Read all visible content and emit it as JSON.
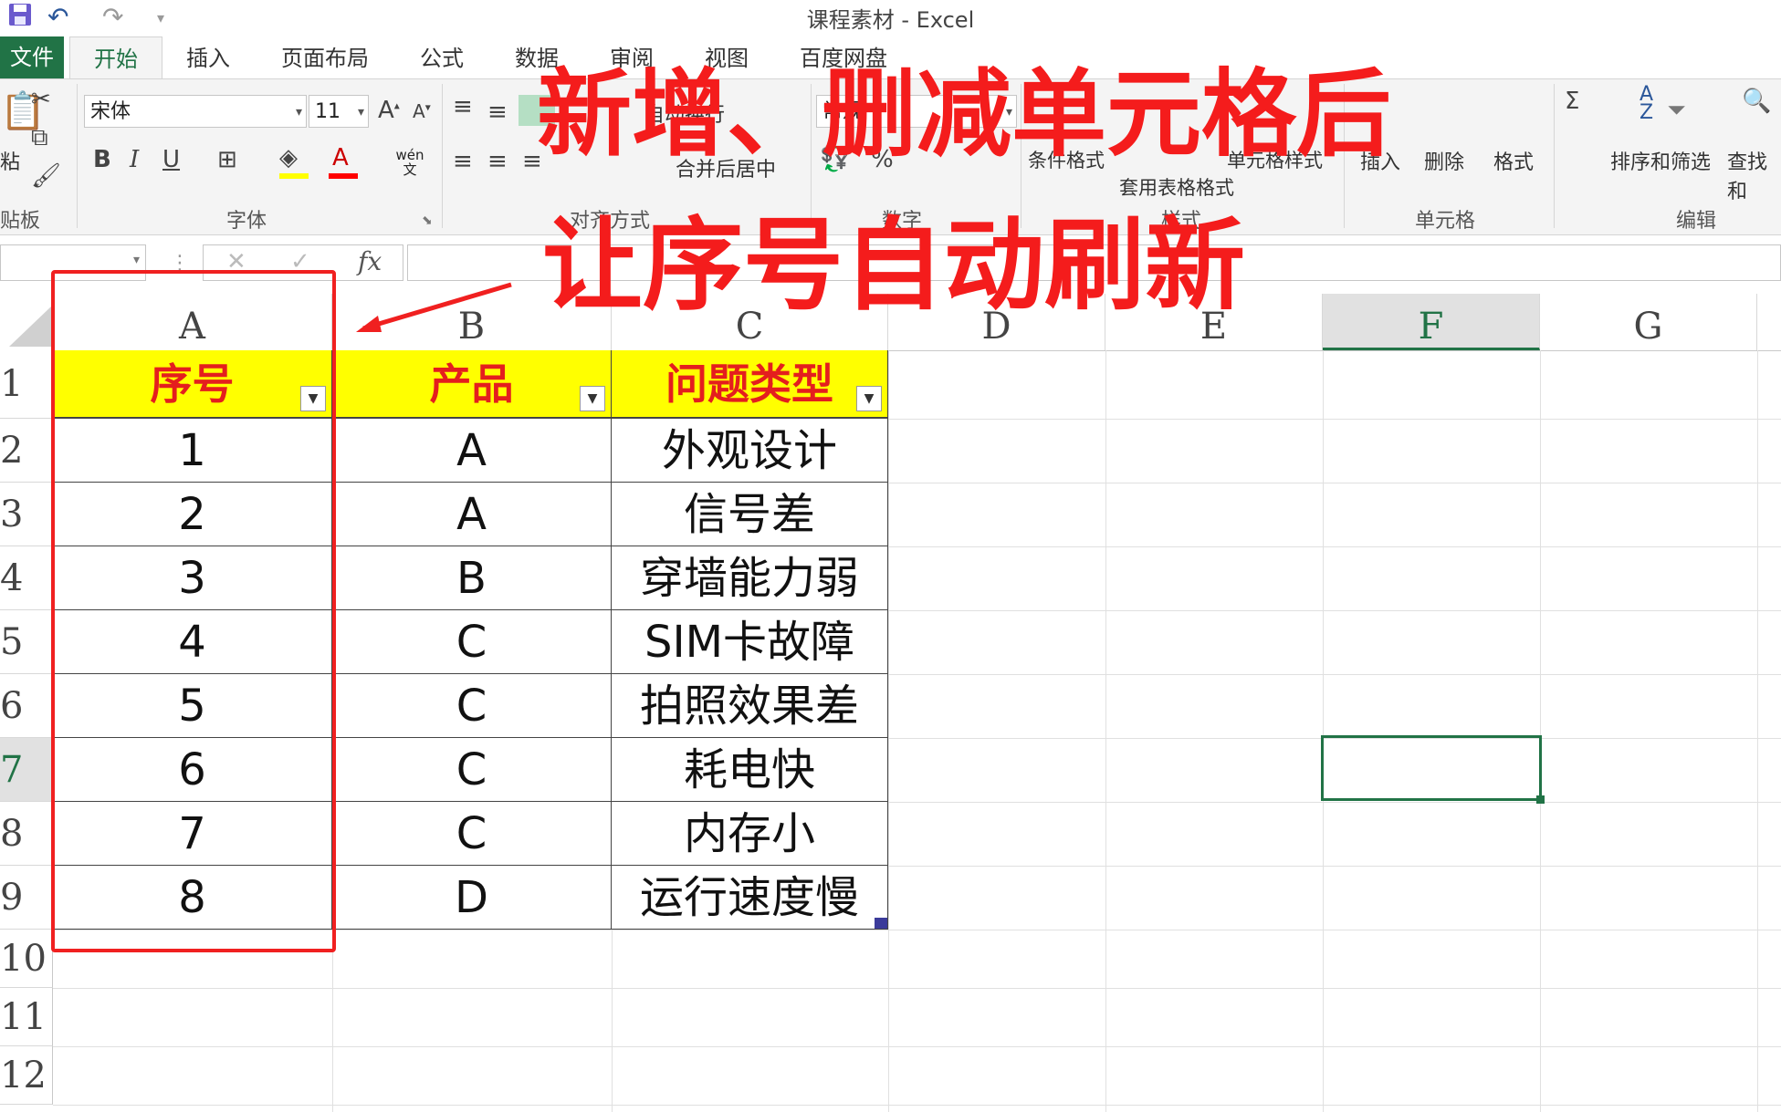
{
  "window": {
    "title": "课程素材 - Excel"
  },
  "ribbon": {
    "tabs": [
      "文件",
      "开始",
      "插入",
      "页面布局",
      "公式",
      "数据",
      "审阅",
      "视图",
      "百度网盘"
    ],
    "active_tab": "开始",
    "font_name": "宋体",
    "font_size": "11",
    "number_format": "常规",
    "bold": "B",
    "italic": "I",
    "underline": "U",
    "phonetic": "wén 文",
    "percent": "%",
    "cond_format": "条件格式",
    "table_format": "套用表格格式",
    "cell_style": "单元格样式",
    "insert": "插入",
    "delete": "删除",
    "format": "格式",
    "sort_filter": "排序和筛选",
    "find_select": "查找和",
    "wrap_text": "自动换行",
    "merge_center": "合并后居中",
    "groups": {
      "clipboard": "贴板",
      "paste": "粘",
      "font": "字体",
      "alignment": "对齐方式",
      "number": "数字",
      "styles": "样式",
      "cells": "单元格",
      "editing": "编辑"
    }
  },
  "formula_bar": {
    "fx": "fx",
    "cancel": "✕",
    "confirm": "✓"
  },
  "grid": {
    "columns": [
      "A",
      "B",
      "C",
      "D",
      "E",
      "F",
      "G"
    ],
    "rows": [
      "1",
      "2",
      "3",
      "4",
      "5",
      "6",
      "7",
      "8",
      "9",
      "10",
      "11",
      "12"
    ],
    "selected_column": "F",
    "selected_row": "7",
    "header": [
      "序号",
      "产品",
      "问题类型"
    ],
    "data": [
      [
        "1",
        "A",
        "外观设计"
      ],
      [
        "2",
        "A",
        "信号差"
      ],
      [
        "3",
        "B",
        "穿墙能力弱"
      ],
      [
        "4",
        "C",
        "SIM卡故障"
      ],
      [
        "5",
        "C",
        "拍照效果差"
      ],
      [
        "6",
        "C",
        "耗电快"
      ],
      [
        "7",
        "C",
        "内存小"
      ],
      [
        "8",
        "D",
        "运行速度慢"
      ]
    ]
  },
  "overlay": {
    "line1": "新增、删减单元格后",
    "line2": "让序号自动刷新"
  },
  "colors": {
    "excel_green": "#217346",
    "header_fill": "#ffff00",
    "header_text": "#e41e1e",
    "annotation_red": "#f41c1c"
  }
}
